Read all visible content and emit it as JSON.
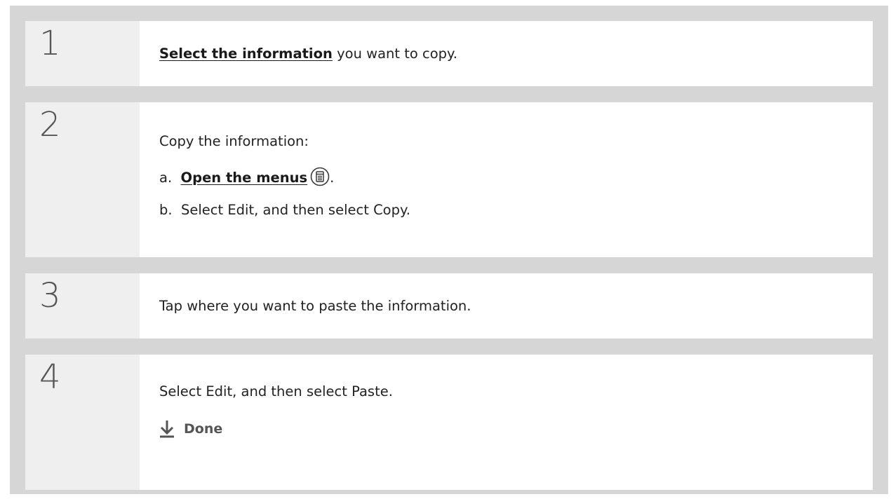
{
  "steps": [
    {
      "number": "1",
      "link": "Select the information",
      "text_after_link": " you want to copy."
    },
    {
      "number": "2",
      "intro": "Copy the information:",
      "sub_a_prefix": "a.  ",
      "sub_a_link": "Open the menus",
      "sub_a_suffix": ".",
      "sub_a_icon": "menu-icon",
      "sub_b": "b.  Select Edit, and then select Copy."
    },
    {
      "number": "3",
      "text": "Tap where you want to paste the information."
    },
    {
      "number": "4",
      "text": "Select Edit, and then select Paste.",
      "done_icon": "down-arrow-icon",
      "done_label": "Done"
    }
  ]
}
